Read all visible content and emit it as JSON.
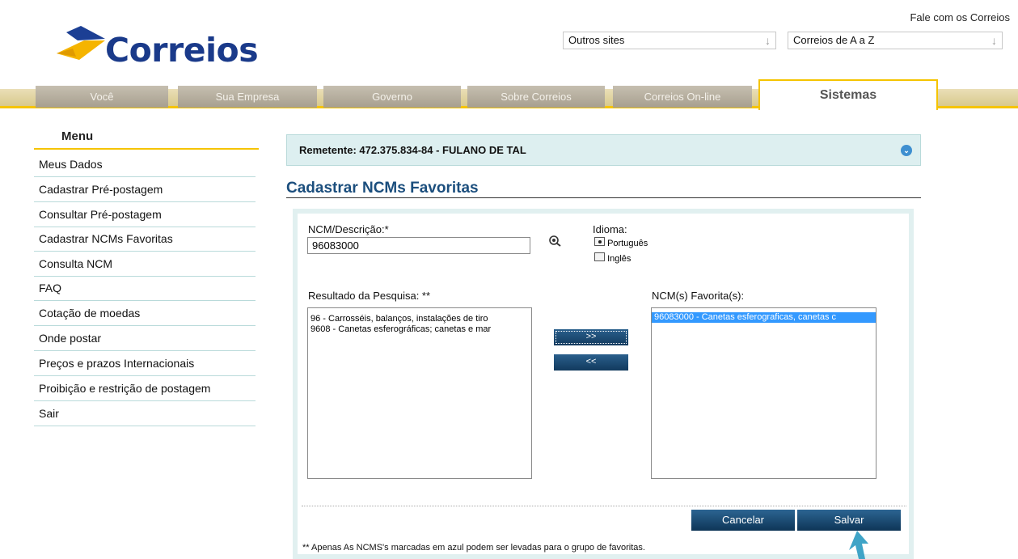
{
  "header": {
    "brand": "Correios",
    "fale_link": "Fale com os Correios",
    "select_outros": "Outros sites",
    "select_az": "Correios de A a Z"
  },
  "nav": {
    "tabs": [
      "Você",
      "Sua Empresa",
      "Governo",
      "Sobre Correios",
      "Correios On-line"
    ],
    "active_tab": "Sistemas"
  },
  "menu": {
    "title": "Menu",
    "items": [
      "Meus Dados",
      "Cadastrar Pré-postagem",
      "Consultar Pré-postagem",
      "Cadastrar NCMs Favoritas",
      "Consulta NCM",
      "FAQ",
      "Cotação de moedas",
      "Onde postar",
      "Preços e prazos Internacionais",
      "Proibição e restrição de postagem",
      "Sair"
    ]
  },
  "remetente": "Remetente: 472.375.834-84 - FULANO DE TAL",
  "page_title": "Cadastrar NCMs Favoritas",
  "form": {
    "ncm_label": "NCM/Descrição:*",
    "ncm_value": "96083000",
    "idioma_label": "Idioma:",
    "idioma_options": [
      "Português",
      "Inglês"
    ],
    "idioma_selected": "Português",
    "resultado_label": "Resultado da Pesquisa: **",
    "resultado_items": [
      "96 - Carrosséis, balanços, instalações de tiro",
      "9608 - Canetas esferográficas; canetas e mar"
    ],
    "favoritas_label": "NCM(s) Favorita(s):",
    "favoritas_items": [
      "96083000 - Canetas esferograficas, canetas c"
    ],
    "btn_add": ">>",
    "btn_remove": "<<",
    "btn_cancel": "Cancelar",
    "btn_save": "Salvar",
    "footnote": "** Apenas As NCMS's marcadas em azul podem ser levadas para o grupo de favoritas."
  },
  "colors": {
    "accent_yellow": "#f5c400",
    "title_blue": "#1b4e7d",
    "button_blue": "#123a5e",
    "selection_blue": "#3399ff"
  }
}
